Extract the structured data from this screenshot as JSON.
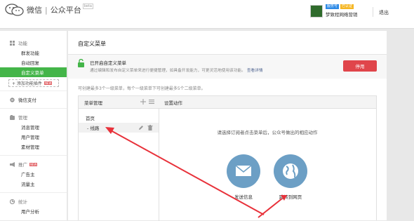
{
  "header": {
    "brand": "微信",
    "separator": "|",
    "product": "公众平台",
    "beta": "beta",
    "badges": [
      {
        "text": "服务号",
        "color": "#2f8be6"
      },
      {
        "text": "已认证",
        "color": "#f5b623"
      }
    ],
    "account_name": "梦致程网络营销",
    "logout": "退出"
  },
  "sidebar": {
    "groups": [
      {
        "label": "功能",
        "icon": "grid-icon",
        "items": [
          "群发功能",
          "自动回复",
          "自定义菜单"
        ],
        "active": "自定义菜单"
      },
      {
        "label": "微信支付",
        "icon": "wallet-icon",
        "items": []
      },
      {
        "label": "管理",
        "icon": "folder-icon",
        "items": [
          "消息管理",
          "用户管理",
          "素材管理"
        ]
      },
      {
        "label": "推广",
        "icon": "megaphone-icon",
        "tag": "NEW",
        "items": [
          "广告主",
          "流量主"
        ]
      },
      {
        "label": "统计",
        "icon": "stats-icon",
        "items": [
          "用户分析"
        ]
      }
    ],
    "add_plugin": "+ 添加功能插件",
    "add_plugin_tag": "NEW",
    "accent_color": "#44b549"
  },
  "main": {
    "title": "自定义菜单",
    "notice": {
      "title": "已开启自定义菜单",
      "desc": "通过编辑和发布自定义菜单来进行便捷管理，如具备开发能力，可更灵活地使用该功能。",
      "link": "查看详情",
      "stop_button": "停用",
      "stop_color": "#e0454b"
    },
    "hint": "可创建最多3个一级菜单，每个一级菜单下可创建最多5个二级菜单。",
    "menu_pane": {
      "header": "菜单管理",
      "items": [
        {
          "label": "首页",
          "level": 1
        },
        {
          "label": "- 线路",
          "level": 2
        }
      ]
    },
    "settings_pane": {
      "header": "设置动作",
      "prompt": "请选择订阅者点击菜单后，公众号做出的相应动作",
      "actions": [
        {
          "label": "发送信息",
          "icon": "envelope-icon"
        },
        {
          "label": "跳转到网页",
          "icon": "globe-icon"
        }
      ],
      "action_color": "#6c9fc5"
    }
  },
  "annotation_color": "#e8313a"
}
